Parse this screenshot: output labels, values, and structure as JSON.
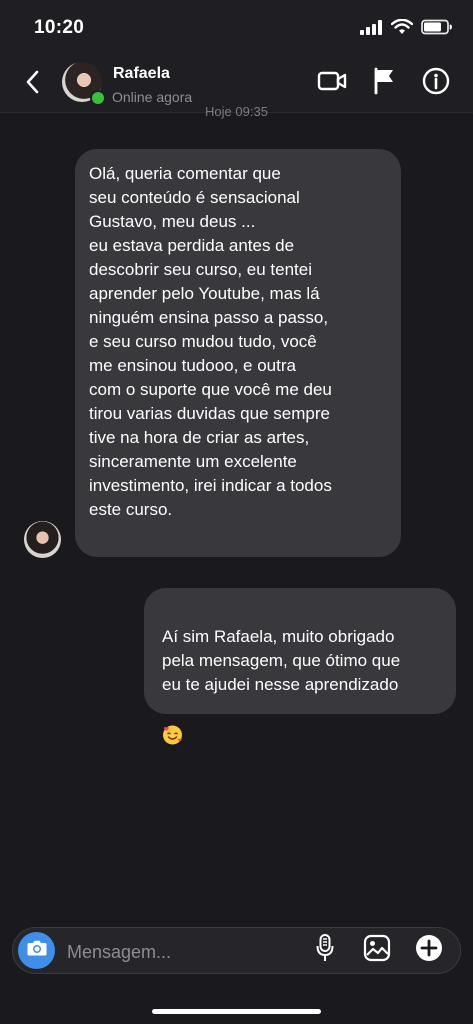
{
  "status_bar": {
    "time": "10:20"
  },
  "header": {
    "back_icon": "chevron-left-icon",
    "contact_name": "Rafaela",
    "contact_status": "Online agora",
    "actions": [
      "video-call-icon",
      "flag-icon",
      "info-icon"
    ]
  },
  "conversation": {
    "timestamp": "Hoje 09:35",
    "messages": [
      {
        "direction": "incoming",
        "text": "Olá, queria comentar que\nseu conteúdo é sensacional\nGustavo, meu deus ...\neu estava perdida antes de\ndescobrir seu curso, eu tentei\naprender pelo Youtube, mas lá\nninguém ensina passo a passo,\ne seu curso mudou tudo, você\nme ensinou tudooo, e outra\ncom o suporte que você me deu\ntirou varias duvidas que sempre\ntive na hora de criar as artes,\nsinceramente um excelente\ninvestimento, irei indicar a todos\neste curso."
      },
      {
        "direction": "outgoing",
        "text": "Aí sim Rafaela, muito obrigado\npela mensagem, que ótimo que\neu te ajudei nesse aprendizado",
        "emoji": "smiling-face-with-hearts-icon"
      }
    ]
  },
  "composer": {
    "placeholder": "Mensagem...",
    "camera_icon": "camera-icon",
    "actions": [
      "microphone-icon",
      "image-icon",
      "plus-icon"
    ]
  },
  "colors": {
    "background": "#1a1a1e",
    "bubble": "#38383d",
    "accent": "#3f8fe8",
    "online": "#37c13d"
  }
}
